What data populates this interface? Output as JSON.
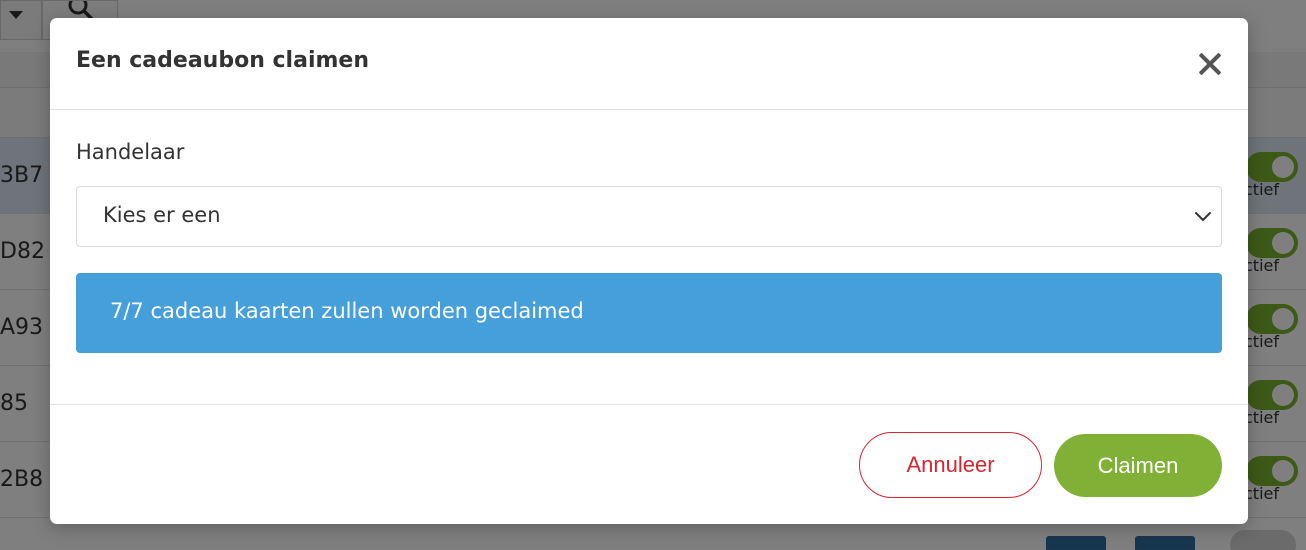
{
  "modal": {
    "title": "Een cadeaubon claimen",
    "close_icon": "close-icon",
    "field_label": "Handelaar",
    "select": {
      "value": "Kies er een",
      "icon": "chevron-down-icon"
    },
    "alert_text": "7/7 cadeau kaarten zullen worden geclaimed",
    "buttons": {
      "cancel": "Annuleer",
      "claim": "Claimen"
    }
  },
  "background": {
    "rows": [
      {
        "code": "3B7",
        "status": "ctief"
      },
      {
        "code": "D82",
        "status": "ctief"
      },
      {
        "code": "A93",
        "status": "ctief"
      },
      {
        "code": "85",
        "status": "ctief"
      },
      {
        "code": "2B8",
        "status": "ctief"
      }
    ]
  },
  "colors": {
    "primary_green": "#80b036",
    "danger_red": "#d9252f",
    "info_blue": "#459fdb"
  }
}
